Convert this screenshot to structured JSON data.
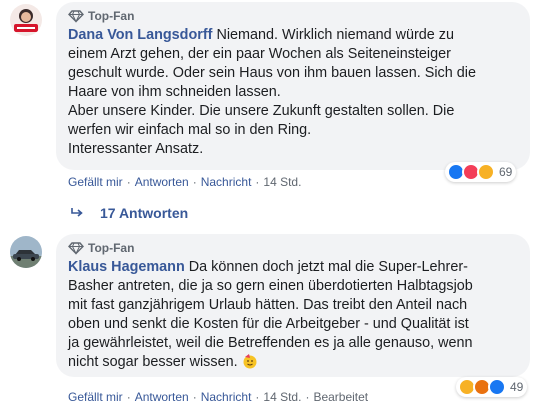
{
  "comments": [
    {
      "badge": "Top-Fan",
      "author": "Dana Von Langsdorff",
      "lines": [
        "Niemand. Wirklich niemand würde zu",
        "einem Arzt gehen, der ein paar Wochen als Seiteneinsteiger",
        "geschult wurde. Oder sein Haus von ihm bauen lassen. Sich die",
        "Haare von ihm schneiden lassen.",
        "Aber unsere Kinder. Die unsere Zukunft gestalten sollen. Die",
        "werfen wir einfach mal so in den Ring.",
        "Interessanter Ansatz."
      ],
      "reaction_count": "69",
      "reactions": [
        "like-icon",
        "love-icon",
        "haha-icon"
      ],
      "actions": {
        "like": "Gefällt mir",
        "reply": "Antworten",
        "message": "Nachricht",
        "time": "14 Std."
      }
    },
    {
      "badge": "Top-Fan",
      "author": "Klaus Hagemann",
      "lines": [
        "Da können doch jetzt mal die Super-Lehrer-",
        "Basher antreten, die ja so gern einen überdotierten Halbtagsjob",
        "mit fast ganzjährigem Urlaub hätten. Das treibt den Anteil nach",
        "oben und senkt die Kosten für die Arbeitgeber - und Qualität ist",
        "ja gewährleistet, weil die Betreffenden es ja alle genauso, wenn",
        "nicht sogar besser wissen."
      ],
      "reaction_count": "49",
      "reactions": [
        "haha-icon",
        "angry-icon",
        "like-icon"
      ],
      "actions": {
        "like": "Gefällt mir",
        "reply": "Antworten",
        "message": "Nachricht",
        "time": "14 Std.",
        "edited": "Bearbeitet"
      }
    }
  ],
  "replies": {
    "label": "17 Antworten"
  },
  "colors": {
    "link": "#385898",
    "bubble": "#f2f3f5",
    "meta": "#606770",
    "like": "#1877f2",
    "love": "#f33e58",
    "haha": "#f7b125",
    "angry": "#e9710f"
  }
}
